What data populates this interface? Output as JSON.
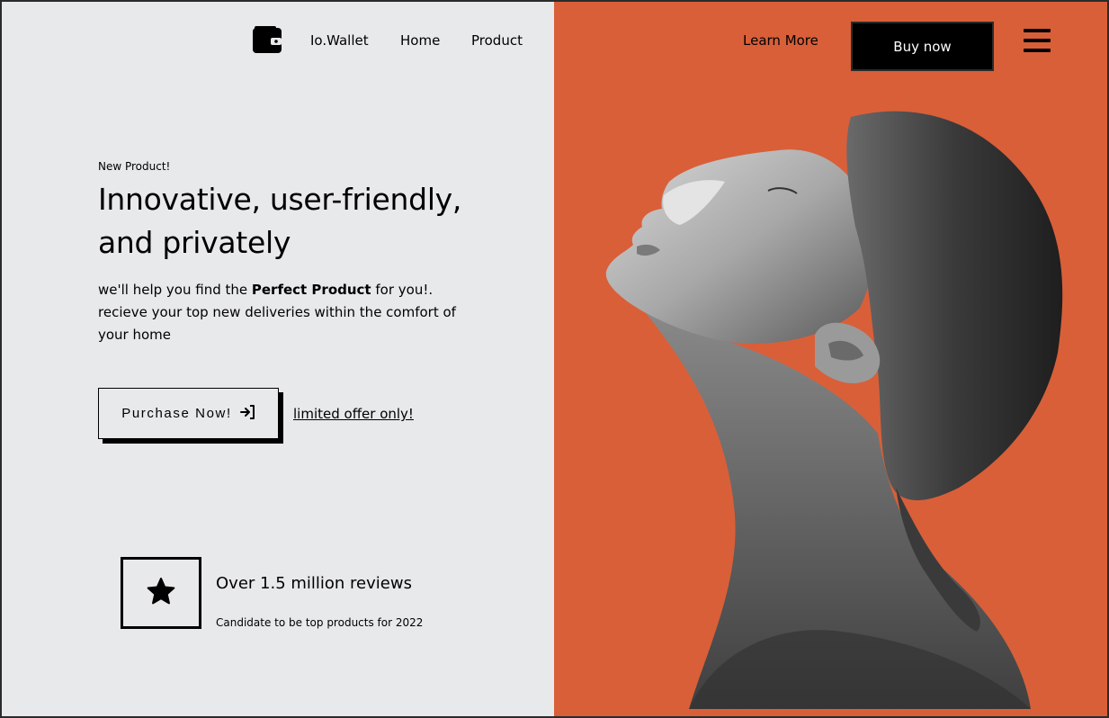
{
  "nav": {
    "brand": "Io.Wallet",
    "links": [
      "Home",
      "Product"
    ],
    "learn_more": "Learn More",
    "buy_now": "Buy now",
    "icons": {
      "logo": "wallet-icon",
      "menu": "hamburger-menu-icon"
    }
  },
  "hero": {
    "eyebrow": "New Product!",
    "headline": "Innovative, user-friendly, and privately",
    "description": {
      "part1": "we'll help you find the ",
      "bold": "Perfect Product",
      "part2": " for you!. recieve your top new deliveries within the comfort of your home"
    },
    "purchase_button": "Purchase Now!",
    "purchase_icon": "sign-in-arrow-icon",
    "limited_offer": "limited offer only!"
  },
  "reviews": {
    "icon": "star-icon",
    "title": "Over 1.5 million reviews",
    "subtitle": "Candidate to be top products for 2022"
  },
  "colors": {
    "left_bg": "#e8e9eb",
    "accent": "#d95f39",
    "text": "#000000",
    "button_bg": "#000000",
    "button_text": "#ffffff"
  }
}
